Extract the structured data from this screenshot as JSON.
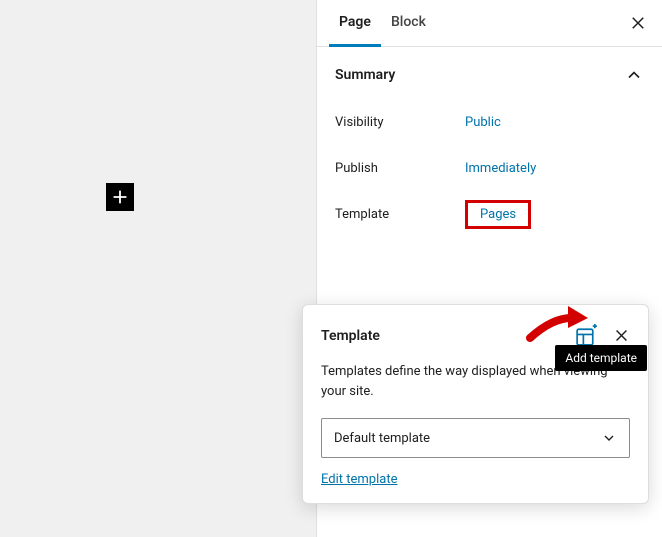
{
  "tabs": {
    "page": "Page",
    "block": "Block"
  },
  "summary": {
    "title": "Summary",
    "visibility_label": "Visibility",
    "visibility_value": "Public",
    "publish_label": "Publish",
    "publish_value": "Immediately",
    "template_label": "Template",
    "template_value": "Pages"
  },
  "popover": {
    "title": "Template",
    "description": "Templates define the way displayed when viewing your site.",
    "select_value": "Default template",
    "edit_link": "Edit template"
  },
  "tooltip": {
    "add_template": "Add template"
  }
}
